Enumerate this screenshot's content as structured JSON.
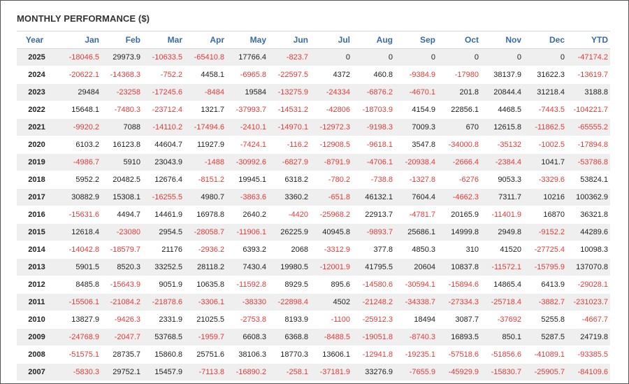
{
  "title": "MONTHLY PERFORMANCE ($)",
  "colors": {
    "header_text": "#3b6ba5",
    "negative": "#e83a3a",
    "positive": "#222222",
    "stripe": "#efefef"
  },
  "chart_data": {
    "type": "table",
    "title": "MONTHLY PERFORMANCE ($)",
    "columns": [
      "Year",
      "Jan",
      "Feb",
      "Mar",
      "Apr",
      "May",
      "Jun",
      "Jul",
      "Aug",
      "Sep",
      "Oct",
      "Nov",
      "Dec",
      "YTD"
    ],
    "rows": [
      [
        "2025",
        "-18046.5",
        "29973.9",
        "-10633.5",
        "-65410.8",
        "17766.4",
        "-823.7",
        "0",
        "0",
        "0",
        "0",
        "0",
        "0",
        "-47174.2"
      ],
      [
        "2024",
        "-20622.1",
        "-14368.3",
        "-752.2",
        "4458.1",
        "-6965.8",
        "-22597.5",
        "4372",
        "460.8",
        "-9384.9",
        "-17980",
        "38137.9",
        "31622.3",
        "-13619.7"
      ],
      [
        "2023",
        "29484",
        "-23258",
        "-17245.6",
        "-8484",
        "19584",
        "-13275.9",
        "-24334",
        "-6876.2",
        "-4670.1",
        "201.8",
        "20844.4",
        "31218.4",
        "3188.8"
      ],
      [
        "2022",
        "15648.1",
        "-7480.3",
        "-23712.4",
        "1321.7",
        "-37993.7",
        "-14531.2",
        "-42806",
        "-18703.9",
        "4154.9",
        "22856.1",
        "4468.5",
        "-7443.5",
        "-104221.7"
      ],
      [
        "2021",
        "-9920.2",
        "7088",
        "-14110.2",
        "-17494.6",
        "-2410.1",
        "-14970.1",
        "-12972.3",
        "-9198.3",
        "7009.3",
        "670",
        "12615.8",
        "-11862.5",
        "-65555.2"
      ],
      [
        "2020",
        "6103.2",
        "16123.8",
        "44604.7",
        "11927.9",
        "-7424.1",
        "-116.2",
        "-12908.5",
        "-9618.1",
        "3547.8",
        "-34000.8",
        "-35132",
        "-1002.5",
        "-17894.8"
      ],
      [
        "2019",
        "-4986.7",
        "5910",
        "23043.9",
        "-1488",
        "-30992.6",
        "-6827.9",
        "-8791.9",
        "-4706.1",
        "-20938.4",
        "-2666.4",
        "-2384.4",
        "1041.7",
        "-53786.8"
      ],
      [
        "2018",
        "5952.2",
        "20482.5",
        "12676.4",
        "-8151.2",
        "19945.1",
        "6318.2",
        "-780.2",
        "-738.8",
        "-1327.8",
        "-6276",
        "9053.3",
        "-3329.6",
        "53824.1"
      ],
      [
        "2017",
        "30882.9",
        "15308.1",
        "-16255.5",
        "4980.7",
        "-3863.6",
        "3360.2",
        "-651.8",
        "46132.1",
        "7604.4",
        "-4662.3",
        "7311.7",
        "10216",
        "100362.9"
      ],
      [
        "2016",
        "-15631.6",
        "4494.7",
        "14461.9",
        "16978.8",
        "2640.2",
        "-4420",
        "-25968.2",
        "22913.7",
        "-4781.7",
        "20165.9",
        "-11401.9",
        "16870",
        "36321.8"
      ],
      [
        "2015",
        "12618.4",
        "-23080",
        "2954.5",
        "-28058.7",
        "-11906.1",
        "26225.9",
        "40945.8",
        "-9893.7",
        "25686.1",
        "14999.8",
        "2949.8",
        "-9152.2",
        "44289.6"
      ],
      [
        "2014",
        "-14042.8",
        "-18579.7",
        "21176",
        "-2936.2",
        "6393.2",
        "2068",
        "-3312.9",
        "377.8",
        "4850.3",
        "310",
        "41520",
        "-27725.4",
        "10098.3"
      ],
      [
        "2013",
        "5901.5",
        "8520.3",
        "33252.5",
        "28118.2",
        "7430.4",
        "19980.5",
        "-12001.9",
        "41795.5",
        "20604",
        "10837.8",
        "-11572.1",
        "-15795.9",
        "137070.8"
      ],
      [
        "2012",
        "8485.8",
        "-15643.9",
        "9051.9",
        "10635.8",
        "-11592.8",
        "8929.5",
        "895.6",
        "-14580.6",
        "-30594.1",
        "-15894.6",
        "14865.4",
        "6413.9",
        "-29028.1"
      ],
      [
        "2011",
        "-15506.1",
        "-21084.2",
        "-21878.6",
        "-3306.1",
        "-38330",
        "-22898.4",
        "4502",
        "-21248.2",
        "-34338.7",
        "-27334.3",
        "-25718.4",
        "-3882.7",
        "-231023.7"
      ],
      [
        "2010",
        "13827.9",
        "-9426.3",
        "2331.9",
        "21025.5",
        "-2753.8",
        "8193.9",
        "-1100",
        "-25912.3",
        "18494",
        "3087.7",
        "-37692",
        "5255.8",
        "-4667.7"
      ],
      [
        "2009",
        "-24768.9",
        "-2047.7",
        "53768.5",
        "-1959.7",
        "6608.3",
        "6368.8",
        "-8488.5",
        "-19051.8",
        "-8740.3",
        "16893.5",
        "850.1",
        "5287.5",
        "24719.8"
      ],
      [
        "2008",
        "-51575.1",
        "28735.7",
        "15860.8",
        "25751.6",
        "38106.3",
        "18770.3",
        "13606.1",
        "-12941.8",
        "-19235.1",
        "-57518.6",
        "-51856.6",
        "-41089.1",
        "-93385.5"
      ],
      [
        "2007",
        "-5830.3",
        "29752.1",
        "15457.9",
        "-7113.8",
        "-16890.2",
        "-258.1",
        "-37181.9",
        "33276.9",
        "-7655.9",
        "-45929.9",
        "-15830.7",
        "-25905.7",
        "-84109.6"
      ]
    ]
  }
}
